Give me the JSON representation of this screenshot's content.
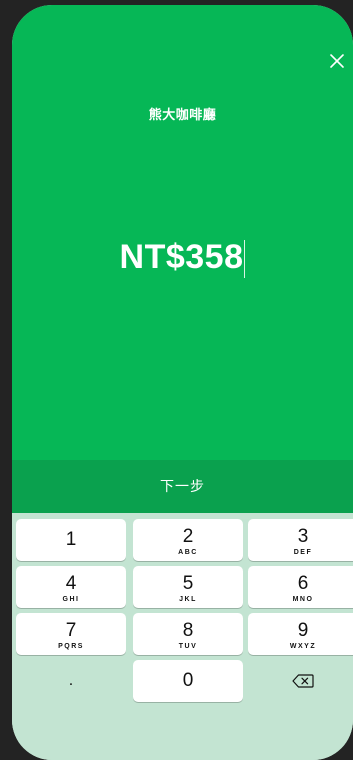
{
  "payment": {
    "merchant_name": "熊大咖啡廳",
    "amount": "NT$358",
    "next_label": "下一步"
  },
  "keypad": {
    "keys": [
      {
        "digit": "1",
        "letters": ""
      },
      {
        "digit": "2",
        "letters": "ABC"
      },
      {
        "digit": "3",
        "letters": "DEF"
      },
      {
        "digit": "4",
        "letters": "GHI"
      },
      {
        "digit": "5",
        "letters": "JKL"
      },
      {
        "digit": "6",
        "letters": "MNO"
      },
      {
        "digit": "7",
        "letters": "PQRS"
      },
      {
        "digit": "8",
        "letters": "TUV"
      },
      {
        "digit": "9",
        "letters": "WXYZ"
      }
    ],
    "decimal": ".",
    "zero": "0"
  },
  "icons": {
    "close": "close-icon",
    "backspace": "backspace-icon"
  },
  "colors": {
    "brand_green": "#06b756",
    "next_bar_green": "#0aa14e",
    "keypad_background": "#c3e4d2"
  }
}
